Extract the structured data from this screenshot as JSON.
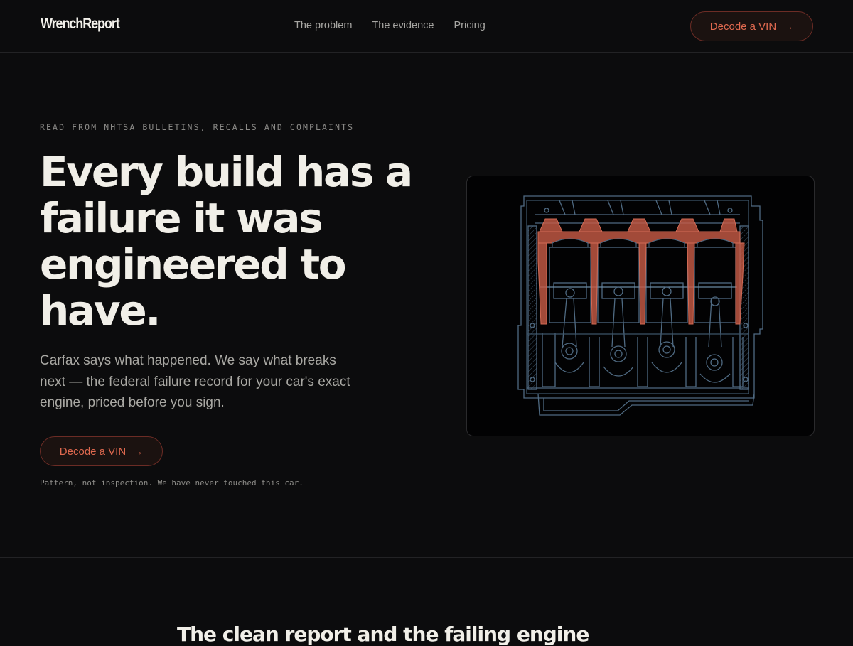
{
  "brand": {
    "logo_text": "WrenchReport"
  },
  "nav": {
    "links": [
      "The problem",
      "The evidence",
      "Pricing"
    ],
    "cta_label": "Decode a VIN",
    "cta_icon": "arrow-right-icon"
  },
  "hero": {
    "eyebrow": "READ FROM NHTSA BULLETINS, RECALLS AND COMPLAINTS",
    "headline": "Every build has a failure it was engineered to have.",
    "subhead": "Carfax says what happened. We say what breaks next — the federal failure record for your car's exact engine, priced before you sign.",
    "cta_label": "Decode a VIN",
    "cta_icon": "arrow-right-icon",
    "disclaimer": "Pattern, not inspection. We have never touched this car."
  },
  "illustration": {
    "icon": "engine-block-cutaway-icon",
    "line_color": "#4f6a82",
    "highlight_color": "#c65a45"
  },
  "next_section": {
    "title": "The clean report and the failing engine"
  },
  "colors": {
    "background": "#0c0c0d",
    "accent": "#e0694f",
    "text": "#f1efe8",
    "muted": "#a9a8a3"
  }
}
